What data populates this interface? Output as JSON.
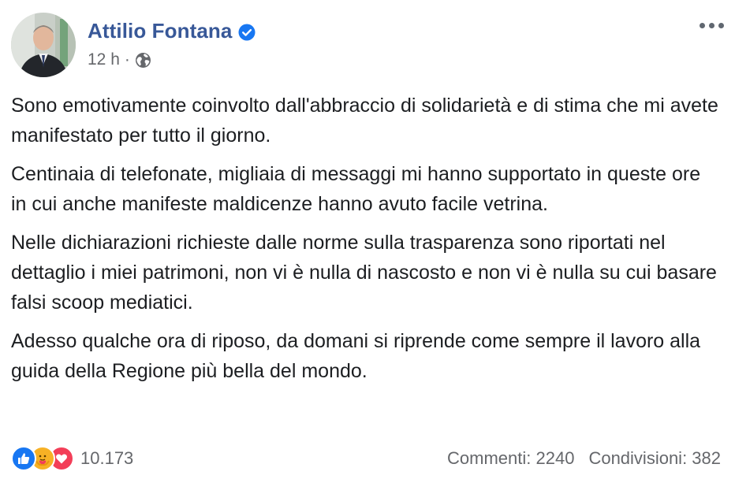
{
  "post": {
    "author": "Attilio Fontana",
    "time": "12 h",
    "separator": "·",
    "paragraphs": [
      "Sono emotivamente coinvolto dall'abbraccio di solidarietà e di stima che mi avete manifestato per tutto il giorno.",
      "Centinaia di telefonate, migliaia di messaggi mi hanno supportato in queste ore in cui anche manifeste maldicenze hanno avuto facile vetrina.",
      "Nelle dichiarazioni richieste dalle norme sulla trasparenza sono riportati nel dettaglio i miei patrimoni, non vi è nulla di nascosto e non vi è nulla su cui basare falsi scoop mediatici.",
      "Adesso qualche ora di riposo, da domani si riprende come sempre il lavoro alla guida della Regione più bella del mondo."
    ]
  },
  "footer": {
    "reactions": [
      "like-icon",
      "care-icon",
      "love-icon"
    ],
    "reaction_count": "10.173",
    "comments": "Commenti: 2240",
    "shares": "Condivisioni: 382"
  },
  "colors": {
    "author": "#385898",
    "verified": "#1877f2",
    "meta": "#65676b",
    "like": "#1877f2",
    "care": "#f7b125",
    "love": "#f33e58"
  }
}
